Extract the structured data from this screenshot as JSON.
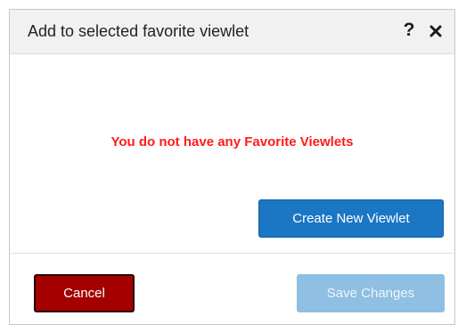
{
  "dialog": {
    "title": "Add to selected favorite viewlet",
    "help_icon": "question-mark-icon",
    "help_glyph": "?",
    "close_icon": "close-icon"
  },
  "body": {
    "empty_message": "You do not have any Favorite Viewlets",
    "empty_message_color": "#ff1a1a",
    "create_button_label": "Create New Viewlet"
  },
  "footer": {
    "cancel_label": "Cancel",
    "save_label": "Save Changes",
    "save_disabled": true
  },
  "colors": {
    "primary": "#1b76c4",
    "cancel": "#a50000",
    "disabled": "#8fbfe2",
    "header_bg": "#f1f1f1"
  }
}
